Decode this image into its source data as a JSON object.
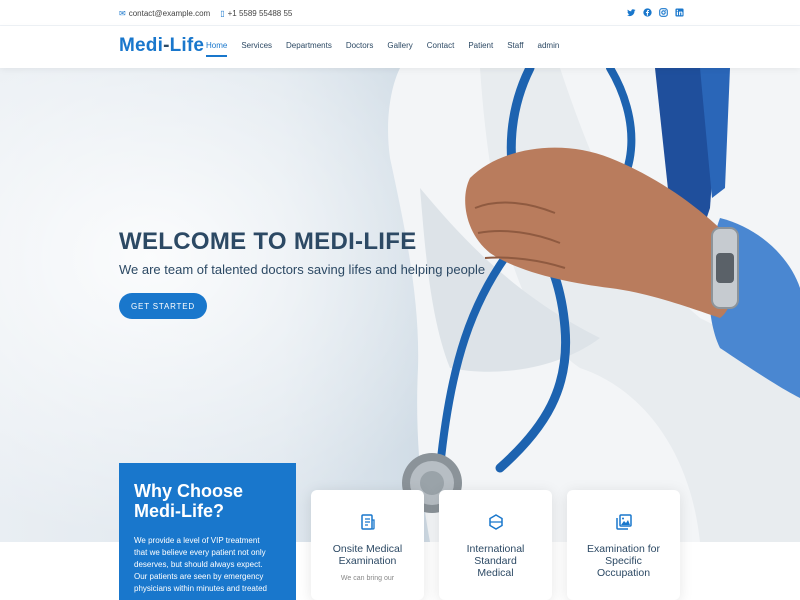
{
  "topbar": {
    "email": "contact@example.com",
    "phone": "+1 5589 55488 55",
    "social": [
      "twitter-icon",
      "facebook-icon",
      "instagram-icon",
      "linkedin-icon"
    ]
  },
  "header": {
    "logo_part1": "Medi",
    "logo_dash": "-",
    "logo_part2": "Life",
    "nav": [
      "Home",
      "Services",
      "Departments",
      "Doctors",
      "Gallery",
      "Contact",
      "Patient",
      "Staff",
      "admin"
    ]
  },
  "hero": {
    "title": "WELCOME TO MEDI-LIFE",
    "subtitle": "We are team of talented doctors saving lifes and helping people",
    "button": "GET STARTED"
  },
  "why": {
    "title_line1": "Why Choose",
    "title_line2": "Medi-Life?",
    "text_line1": "We provide a level of VIP treatment",
    "text_line2": "that we believe every patient not only",
    "text_line3": "deserves, but should always expect.",
    "text_line4": "Our patients are seen by emergency",
    "text_line5": "physicians within minutes and treated"
  },
  "cards": [
    {
      "title_line1": "Onsite Medical",
      "title_line2": "Examination",
      "title_line3": "",
      "text": "We can bring our",
      "icon": "receipt-icon"
    },
    {
      "title_line1": "International",
      "title_line2": "Standard",
      "title_line3": "Medical",
      "text": "",
      "icon": "cube-icon"
    },
    {
      "title_line1": "Examination for",
      "title_line2": "Specific",
      "title_line3": "Occupation",
      "text": "",
      "icon": "images-icon"
    }
  ],
  "colors": {
    "accent": "#1977cc",
    "heading": "#2c4964"
  }
}
